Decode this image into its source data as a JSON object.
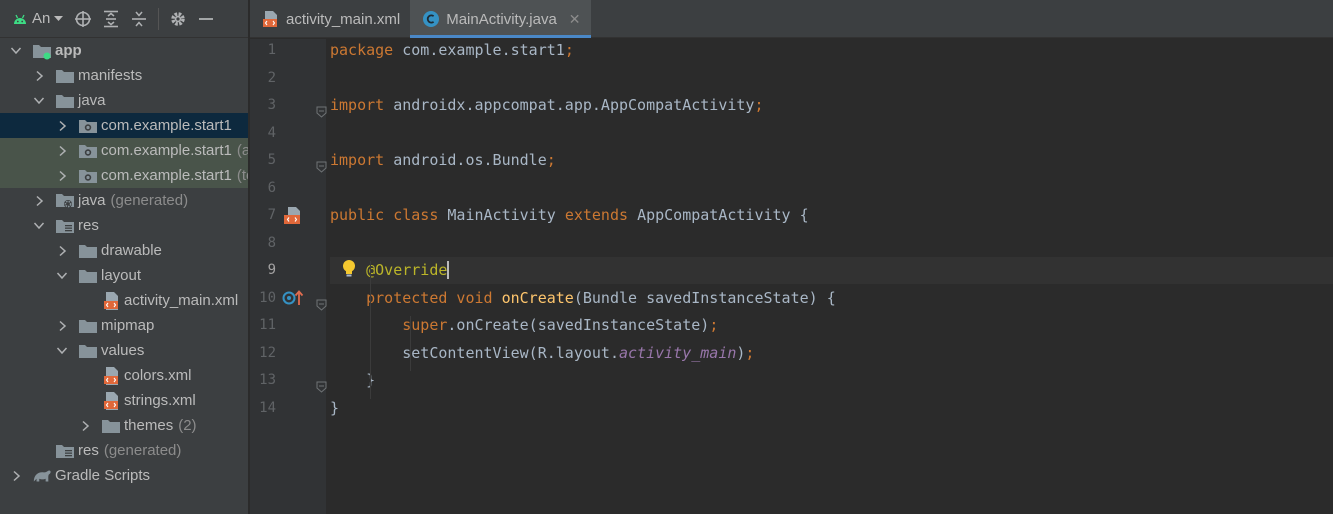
{
  "project_panel": {
    "title": "An...",
    "title_display": "An",
    "tree": [
      {
        "label": "app",
        "hint": "",
        "depth": 0,
        "arrow": "down",
        "icon": "module-folder-icon",
        "bold": true
      },
      {
        "label": "manifests",
        "hint": "",
        "depth": 1,
        "arrow": "right",
        "icon": "folder-icon"
      },
      {
        "label": "java",
        "hint": "",
        "depth": 1,
        "arrow": "down",
        "icon": "folder-icon"
      },
      {
        "label": "com.example.start1",
        "hint": "",
        "depth": 2,
        "arrow": "right",
        "icon": "package-icon",
        "state": "selected"
      },
      {
        "label": "com.example.start1",
        "hint": "(ar",
        "depth": 2,
        "arrow": "right",
        "icon": "package-icon",
        "state": "test"
      },
      {
        "label": "com.example.start1",
        "hint": "(te",
        "depth": 2,
        "arrow": "right",
        "icon": "package-icon",
        "state": "test"
      },
      {
        "label": "java",
        "hint": "(generated)",
        "depth": 1,
        "arrow": "right",
        "icon": "generated-folder-icon"
      },
      {
        "label": "res",
        "hint": "",
        "depth": 1,
        "arrow": "down",
        "icon": "res-folder-icon"
      },
      {
        "label": "drawable",
        "hint": "",
        "depth": 2,
        "arrow": "right",
        "icon": "folder-icon"
      },
      {
        "label": "layout",
        "hint": "",
        "depth": 2,
        "arrow": "down",
        "icon": "folder-icon"
      },
      {
        "label": "activity_main.xml",
        "hint": "",
        "depth": 3,
        "arrow": "none",
        "icon": "xml-file-icon"
      },
      {
        "label": "mipmap",
        "hint": "",
        "depth": 2,
        "arrow": "right",
        "icon": "folder-icon"
      },
      {
        "label": "values",
        "hint": "",
        "depth": 2,
        "arrow": "down",
        "icon": "folder-icon"
      },
      {
        "label": "colors.xml",
        "hint": "",
        "depth": 3,
        "arrow": "none",
        "icon": "xml-file-icon"
      },
      {
        "label": "strings.xml",
        "hint": "",
        "depth": 3,
        "arrow": "none",
        "icon": "xml-file-icon"
      },
      {
        "label": "themes",
        "hint": "(2)",
        "depth": 3,
        "arrow": "right",
        "icon": "folder-icon"
      },
      {
        "label": "res",
        "hint": "(generated)",
        "depth": 1,
        "arrow": "none",
        "icon": "res-folder-icon"
      },
      {
        "label": "Gradle Scripts",
        "hint": "",
        "depth": 0,
        "arrow": "right",
        "icon": "gradle-icon"
      }
    ]
  },
  "tabs": [
    {
      "label": "activity_main.xml",
      "icon": "xml-file-icon",
      "active": false
    },
    {
      "label": "MainActivity.java",
      "icon": "java-class-icon",
      "active": true
    }
  ],
  "editor": {
    "current_line": 9,
    "lines": [
      {
        "n": "1",
        "tokens": [
          [
            "kw",
            "package "
          ],
          [
            "pl",
            "com.example.start1"
          ],
          [
            "kw",
            ";"
          ]
        ]
      },
      {
        "n": "2",
        "tokens": []
      },
      {
        "n": "3",
        "tokens": [
          [
            "kw",
            "import "
          ],
          [
            "pl",
            "androidx.appcompat.app.AppCompatActivity"
          ],
          [
            "kw",
            ";"
          ]
        ],
        "fold": true
      },
      {
        "n": "4",
        "tokens": []
      },
      {
        "n": "5",
        "tokens": [
          [
            "kw",
            "import "
          ],
          [
            "pl",
            "android.os.Bundle"
          ],
          [
            "kw",
            ";"
          ]
        ],
        "fold": true
      },
      {
        "n": "6",
        "tokens": []
      },
      {
        "n": "7",
        "tokens": [
          [
            "kw",
            "public class "
          ],
          [
            "pl",
            "MainActivity "
          ],
          [
            "kw",
            "extends "
          ],
          [
            "pl",
            "AppCompatActivity {"
          ]
        ],
        "gicon": "layout-file-marker-icon"
      },
      {
        "n": "8",
        "tokens": []
      },
      {
        "n": "9",
        "tokens": [
          [
            "pl",
            "    "
          ],
          [
            "ann",
            "@Override"
          ]
        ],
        "caret": true,
        "gicon": "lightbulb-icon"
      },
      {
        "n": "10",
        "tokens": [
          [
            "pl",
            "    "
          ],
          [
            "kw",
            "protected void "
          ],
          [
            "meth",
            "onCreate"
          ],
          [
            "pl",
            "(Bundle savedInstanceState) {"
          ]
        ],
        "gicon": "override-marker-icon",
        "fold": true
      },
      {
        "n": "11",
        "tokens": [
          [
            "pl",
            "        "
          ],
          [
            "kw",
            "super"
          ],
          [
            "pl",
            ".onCreate(savedInstanceState)"
          ],
          [
            "kw",
            ";"
          ]
        ]
      },
      {
        "n": "12",
        "tokens": [
          [
            "pl",
            "        setContentView(R.layout."
          ],
          [
            "field",
            "activity_main"
          ],
          [
            "pl",
            ")"
          ],
          [
            "kw",
            ";"
          ]
        ]
      },
      {
        "n": "13",
        "tokens": [
          [
            "pl",
            "    }"
          ]
        ],
        "fold": true
      },
      {
        "n": "14",
        "tokens": [
          [
            "pl",
            "}"
          ]
        ]
      }
    ]
  },
  "colors": {
    "panel_bg": "#3c3f41",
    "editor_bg": "#2b2b2b",
    "gutter_bg": "#313335",
    "selection": "#0d293e",
    "test_row": "#49544a",
    "tab_underline": "#4a88c7",
    "keyword": "#cc7832",
    "annotation": "#bbb529",
    "method": "#ffc66d",
    "field": "#9876aa",
    "plain": "#a9b7c6"
  }
}
